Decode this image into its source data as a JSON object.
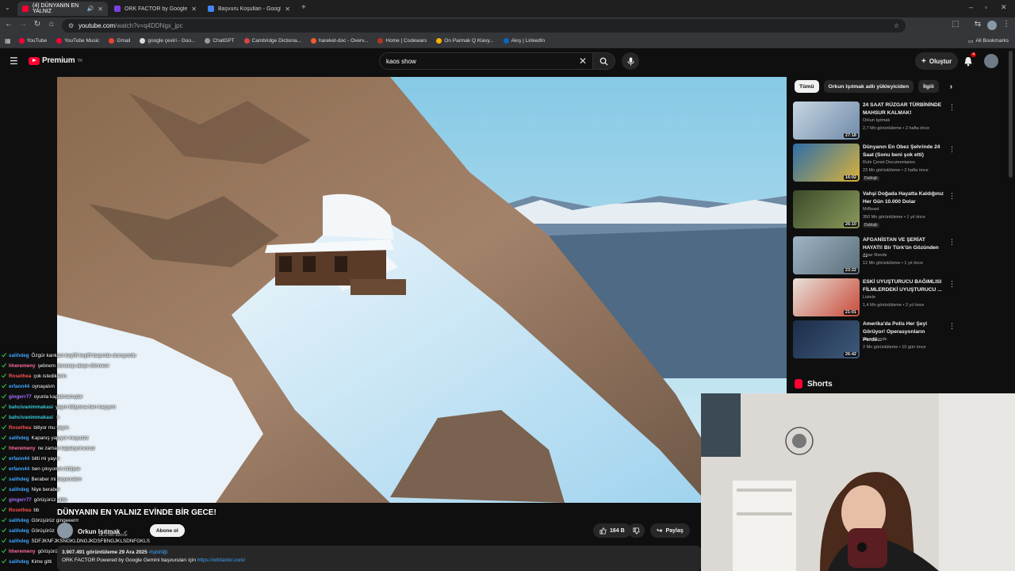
{
  "browser": {
    "tabs": [
      {
        "label": "(4) DÜNYANIN EN YALNIZ",
        "active": true,
        "favicon_color": "#ff0033"
      },
      {
        "label": "ORK FACTOR by Google Gemini",
        "active": false,
        "favicon_color": "#7b3fe4"
      },
      {
        "label": "Başvuru Koşulları - Google Doc",
        "active": false,
        "favicon_color": "#4285f4"
      }
    ],
    "url_host": "youtube.com",
    "url_path": "/watch?v=q4DDNgx_jpc",
    "bookmarks": [
      {
        "label": "YouTube",
        "color": "#ff0033"
      },
      {
        "label": "YouTube Music",
        "color": "#ff0033"
      },
      {
        "label": "Gmail",
        "color": "#ea4335"
      },
      {
        "label": "google çeviri - Goo...",
        "color": "#dddddd"
      },
      {
        "label": "ChatGPT",
        "color": "#999999"
      },
      {
        "label": "Cambridge Dictiona...",
        "color": "#d64545"
      },
      {
        "label": "hareket-doc - Overv...",
        "color": "#f05a28"
      },
      {
        "label": "Home | Codewars",
        "color": "#b1361e"
      },
      {
        "label": "On Parmak Q Klavy...",
        "color": "#f4b400"
      },
      {
        "label": "Akış | LinkedIn",
        "color": "#0a66c2"
      }
    ],
    "all_bookmarks": "All Bookmarks"
  },
  "masthead": {
    "logo_text": "Premium",
    "logo_sup": "TR",
    "search_value": "kaos show",
    "create_label": "Oluştur",
    "notif_count": "4"
  },
  "chat": [
    {
      "user": "salihdeg",
      "color": "#3ea6ff",
      "text": "Özgür kankam keyifli keyifli başında oturuyordu"
    },
    {
      "user": "hheremeny",
      "color": "#ff6b9e",
      "text": "şebnem donanıp ateşe dönmesi"
    },
    {
      "user": "Rosethea",
      "color": "#ff4f4f",
      "text": "çok istediklerin"
    },
    {
      "user": "erfann44",
      "color": "#3ea6ff",
      "text": "oynayalım"
    },
    {
      "user": "gingerr77",
      "color": "#a66bff",
      "text": "oyunla kapatmamışlar"
    },
    {
      "user": "bahcivanimmakasi",
      "color": "#37c9d6",
      "text": "yayın bitiyorsa ben kaçıyım"
    },
    {
      "user": "bahcivanimmakasi",
      "color": "#37c9d6",
      "text": ""
    },
    {
      "user": "Rosethea",
      "color": "#ff4f4f",
      "text": "bitiyor mu yayın"
    },
    {
      "user": "salihdeg",
      "color": "#3ea6ff",
      "text": "Kapanış yapıyor muyuzzz"
    },
    {
      "user": "hheremeny",
      "color": "#ff6b9e",
      "text": "ne zaman kapatıyorsunuz"
    },
    {
      "user": "erfann44",
      "color": "#3ea6ff",
      "text": "bitti mi yayın"
    },
    {
      "user": "erfann44",
      "color": "#3ea6ff",
      "text": "ben çıkıyorum bittiyse"
    },
    {
      "user": "salihdeg",
      "color": "#3ea6ff",
      "text": "Beraber mi başvuralım"
    },
    {
      "user": "salihdeg",
      "color": "#3ea6ff",
      "text": "Niye beraber"
    },
    {
      "user": "gingerr77",
      "color": "#a66bff",
      "text": "görüşürüz abla"
    },
    {
      "user": "Rosethea",
      "color": "#ff4f4f",
      "text": "bb"
    },
    {
      "user": "salihdeg",
      "color": "#3ea6ff",
      "text": "Görüşürüz gingeeerrr"
    },
    {
      "user": "salihdeg",
      "color": "#3ea6ff",
      "text": "Görüşürüz"
    },
    {
      "user": "salihdeg",
      "color": "#3ea6ff",
      "text": "SDFJKNFJKSNGKLDNGJKDSFBNGJKLSDNFGKLS"
    },
    {
      "user": "hheremeny",
      "color": "#ff6b9e",
      "text": "görüşürüz"
    },
    {
      "user": "salihdeg",
      "color": "#3ea6ff",
      "text": "Kime gitti"
    }
  ],
  "video": {
    "title": "DÜNYANIN EN YALNIZ EVİNDE BİR GECE!",
    "channel": "Orkun Işıtmak",
    "subscribers": "12,3 Mn abone",
    "subscribe_label": "Abone ol",
    "likes": "164 B",
    "share_label": "Paylaş",
    "views_date": "3.907.491 görüntüleme  29 Ara 2025",
    "hashtag": "#işbirliği",
    "description": "ORK FACTOR Powered by Google Gemini başvuruları için",
    "link": "https://orkfactor.com/"
  },
  "sidebar": {
    "chips": [
      "Tümü",
      "Orkun Işıtmak adlı yükleyiciden",
      "İlgili"
    ],
    "recommendations": [
      {
        "title": "24 SAAT RÜZGAR TÜRBİNİNDE MAHSUR KALMAK!",
        "channel": "Orkun Işıtmak",
        "meta": "2,7 Mn görüntüleme • 2 hafta önce",
        "duration": "27:18",
        "badge": "",
        "thumb_color": "#6f8aa8"
      },
      {
        "title": "Dünyanın En Obez Şehrinde 24 Saat (Sonu beni şok etti)",
        "channel": "Ruhi Çenet Documentaries",
        "meta": "23 Mn görüntüleme • 2 hafta önce",
        "duration": "16:02",
        "badge": "Dublajlı",
        "thumb_color": "#d9b23a"
      },
      {
        "title": "Vahşi Doğada Hayatta Kaldığınız Her Gün 10.000 Dolar",
        "channel": "MrBeast",
        "meta": "350 Mn görüntüleme • 1 yıl önce",
        "duration": "26:10",
        "badge": "Dublajlı",
        "thumb_color": "#5a6a3e"
      },
      {
        "title": "AFGANİSTAN VE ŞERİAT HAYATI! Bir Türk'ün Gözünden ...",
        "channel": "Alper Rende",
        "meta": "12 Mn görüntüleme • 1 yıl önce",
        "duration": "23:22",
        "badge": "",
        "thumb_color": "#7c8f9c"
      },
      {
        "title": "ESKİ UYUŞTURUCU BAĞIMLISI FİLMLERDEKİ UYUŞTURUCU ...",
        "channel": "Listele",
        "meta": "1,4 Mn görüntüleme • 2 yıl önce",
        "duration": "21:01",
        "badge": "",
        "thumb_color": "#c94a3a"
      },
      {
        "title": "Amerika'da Polis Her Şeyi Görüyor! Operasyonların Perde...",
        "channel": "Alper Rende",
        "meta": "2 Mn görüntüleme • 10 gün önce",
        "duration": "26:42",
        "badge": "",
        "thumb_color": "#3f5a7a"
      }
    ],
    "shorts_label": "Shorts"
  }
}
